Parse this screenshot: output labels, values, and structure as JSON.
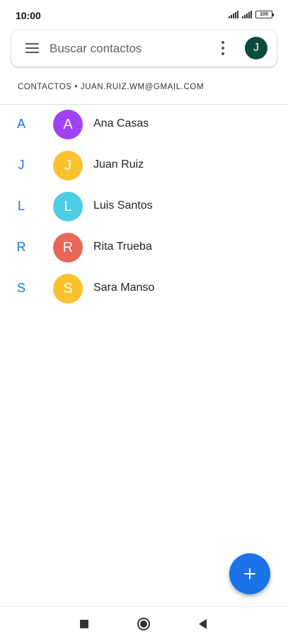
{
  "status_bar": {
    "time": "10:00",
    "battery": "100",
    "icons": [
      "signal-icon",
      "signal-icon",
      "battery-icon"
    ]
  },
  "search": {
    "menu_icon": "menu-icon",
    "placeholder": "Buscar contactos",
    "more_icon": "more-vert-icon",
    "account_initial": "J",
    "account_color": "#0b4b3b"
  },
  "account_header": "CONTACTOS • JUAN.RUIZ.WM@GMAIL.COM",
  "contacts": [
    {
      "letter": "A",
      "initial": "A",
      "name": "Ana Casas",
      "color": "#a142f4"
    },
    {
      "letter": "J",
      "initial": "J",
      "name": "Juan Ruiz",
      "color": "#f9c22e"
    },
    {
      "letter": "L",
      "initial": "L",
      "name": "Luis Santos",
      "color": "#4ecde6"
    },
    {
      "letter": "R",
      "initial": "R",
      "name": "Rita Trueba",
      "color": "#e8675a"
    },
    {
      "letter": "S",
      "initial": "S",
      "name": "Sara Manso",
      "color": "#f9c22e"
    }
  ],
  "accent_color": "#1a73e8",
  "fab": {
    "icon": "add-icon"
  },
  "nav_bar": {
    "icons": [
      "recents-icon",
      "home-icon",
      "back-icon"
    ]
  }
}
